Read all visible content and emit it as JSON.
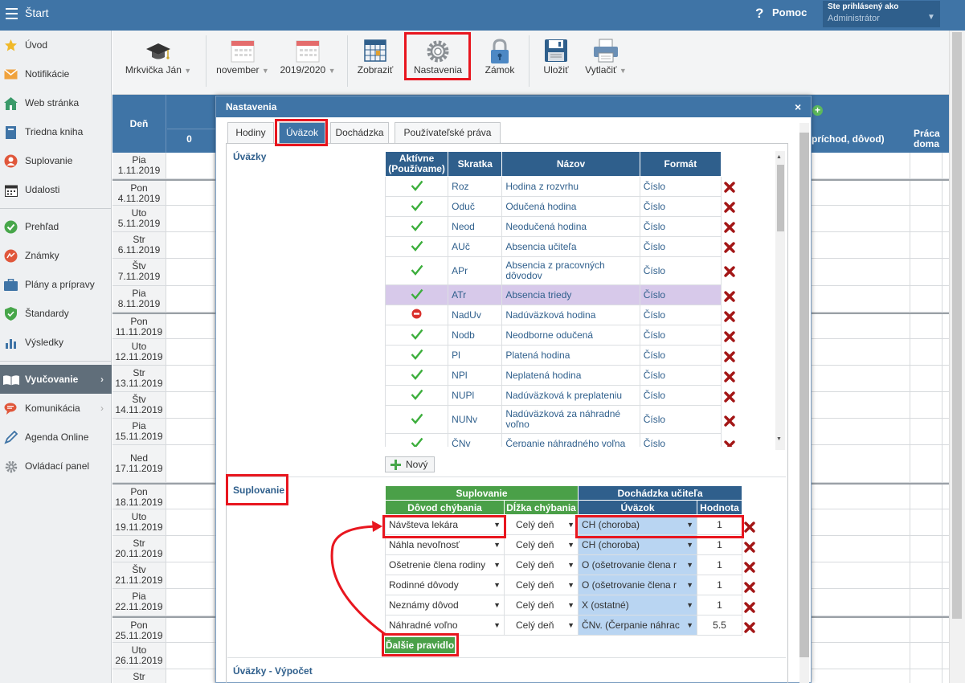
{
  "topbar": {
    "title": "Štart",
    "help_label": "Pomoc",
    "help_icon": "?",
    "user_line1": "Ste prihlásený ako",
    "user_line2": "Administrátor",
    "bg_color": "#3f74a6"
  },
  "sidebar": {
    "items": [
      {
        "label": "Úvod",
        "icon": "star-icon"
      },
      {
        "label": "Notifikácie",
        "icon": "envelope-icon"
      },
      {
        "label": "Web stránka",
        "icon": "home-icon"
      },
      {
        "label": "Triedna kniha",
        "icon": "book-icon"
      },
      {
        "label": "Suplovanie",
        "icon": "person-icon"
      },
      {
        "label": "Udalosti",
        "icon": "calendar-icon"
      },
      {
        "label": "Prehľad",
        "icon": "check-circle-icon"
      },
      {
        "label": "Známky",
        "icon": "grades-icon"
      },
      {
        "label": "Plány a prípravy",
        "icon": "briefcase-icon"
      },
      {
        "label": "Štandardy",
        "icon": "shield-icon"
      },
      {
        "label": "Výsledky",
        "icon": "bar-chart-icon"
      },
      {
        "label": "Vyučovanie",
        "icon": "open-book-icon"
      },
      {
        "label": "Komunikácia",
        "icon": "chat-icon"
      },
      {
        "label": "Agenda Online",
        "icon": "pen-icon"
      },
      {
        "label": "Ovládací panel",
        "icon": "gear-icon"
      }
    ]
  },
  "toolbar": {
    "teacher": "Mrkvička Ján",
    "month": "november",
    "year": "2019/2020",
    "show": "Zobraziť",
    "settings": "Nastavenia",
    "lock": "Zámok",
    "save": "Uložiť",
    "print": "Vytlačiť"
  },
  "calendar": {
    "header_day": "Deň",
    "header_zero": "0",
    "header_reason": "príchod, dôvod)",
    "header_home_1": "Práca",
    "header_home_2": "doma",
    "days": [
      {
        "d": "Pia",
        "date": "1.11.2019"
      },
      {
        "d": "Pon",
        "date": "4.11.2019"
      },
      {
        "d": "Uto",
        "date": "5.11.2019"
      },
      {
        "d": "Str",
        "date": "6.11.2019"
      },
      {
        "d": "Štv",
        "date": "7.11.2019"
      },
      {
        "d": "Pia",
        "date": "8.11.2019"
      },
      {
        "d": "Pon",
        "date": "11.11.2019"
      },
      {
        "d": "Uto",
        "date": "12.11.2019"
      },
      {
        "d": "Str",
        "date": "13.11.2019"
      },
      {
        "d": "Štv",
        "date": "14.11.2019"
      },
      {
        "d": "Pia",
        "date": "15.11.2019"
      },
      {
        "d": "Ned",
        "date": "17.11.2019"
      },
      {
        "d": "Pon",
        "date": "18.11.2019"
      },
      {
        "d": "Uto",
        "date": "19.11.2019"
      },
      {
        "d": "Str",
        "date": "20.11.2019"
      },
      {
        "d": "Štv",
        "date": "21.11.2019"
      },
      {
        "d": "Pia",
        "date": "22.11.2019"
      },
      {
        "d": "Pon",
        "date": "25.11.2019"
      },
      {
        "d": "Uto",
        "date": "26.11.2019"
      },
      {
        "d": "Str",
        "date": ""
      }
    ]
  },
  "modal": {
    "title": "Nastavenia",
    "close": "×",
    "tabs": [
      "Hodiny",
      "Úväzok",
      "Dochádzka",
      "Používateľské práva"
    ],
    "active_tab": "Úväzok",
    "uvazky": {
      "section_title": "Úväzky",
      "headers": [
        "Aktívne (Používame)",
        "Skratka",
        "Názov",
        "Formát"
      ],
      "rows": [
        {
          "active": "yes",
          "code": "Roz",
          "name": "Hodina z rozvrhu",
          "format": "Číslo"
        },
        {
          "active": "yes",
          "code": "Oduč",
          "name": "Odučená hodina",
          "format": "Číslo"
        },
        {
          "active": "yes",
          "code": "Neod",
          "name": "Neodučená hodina",
          "format": "Číslo"
        },
        {
          "active": "yes",
          "code": "AUč",
          "name": "Absencia učiteľa",
          "format": "Číslo"
        },
        {
          "active": "yes",
          "code": "APr",
          "name": "Absencia z pracovných dôvodov",
          "format": "Číslo"
        },
        {
          "active": "yes",
          "code": "ATr",
          "name": "Absencia triedy",
          "format": "Číslo"
        },
        {
          "active": "no",
          "code": "NadUv",
          "name": "Nadúväzková hodina",
          "format": "Číslo"
        },
        {
          "active": "yes",
          "code": "Nodb",
          "name": "Neodborne odučená",
          "format": "Číslo"
        },
        {
          "active": "yes",
          "code": "Pl",
          "name": "Platená hodina",
          "format": "Číslo"
        },
        {
          "active": "yes",
          "code": "NPl",
          "name": "Neplatená hodina",
          "format": "Číslo"
        },
        {
          "active": "yes",
          "code": "NUPl",
          "name": "Nadúväzková k preplateniu",
          "format": "Číslo"
        },
        {
          "active": "yes",
          "code": "NUNv",
          "name": "Nadúväzková za náhradné voľno",
          "format": "Číslo"
        },
        {
          "active": "yes",
          "code": "ČNv",
          "name": "Čerpanie náhradného voľna",
          "format": "Číslo"
        }
      ],
      "new_button": "Nový"
    },
    "suplovanie": {
      "section_title": "Suplovanie",
      "group_sup": "Suplovanie",
      "group_doch": "Dochádzka učiteľa",
      "headers": [
        "Dôvod chýbania",
        "Dĺžka chýbania",
        "Úväzok",
        "Hodnota"
      ],
      "rows": [
        {
          "reason": "Návšteva lekára",
          "length": "Celý deň",
          "uvazok": "CH (choroba)",
          "value": "1"
        },
        {
          "reason": "Náhla nevoľnosť",
          "length": "Celý deň",
          "uvazok": "CH (choroba)",
          "value": "1"
        },
        {
          "reason": "Ošetrenie člena rodiny",
          "length": "Celý deň",
          "uvazok": "O (ošetrovanie člena r",
          "value": "1"
        },
        {
          "reason": "Rodinné dôvody",
          "length": "Celý deň",
          "uvazok": "O (ošetrovanie člena r",
          "value": "1"
        },
        {
          "reason": "Neznámy dôvod",
          "length": "Celý deň",
          "uvazok": "X (ostatné)",
          "value": "1"
        },
        {
          "reason": "Náhradné voľno",
          "length": "Celý deň",
          "uvazok": "ČNv. (Čerpanie náhrac",
          "value": "5.5"
        }
      ],
      "add_button": "Ďalšie pravidlo"
    },
    "vypocet_title": "Úväzky - Výpočet"
  },
  "colors": {
    "accent_blue": "#3f74a6",
    "dark_blue": "#2f5f8c",
    "green": "#4aa048",
    "annotation_red": "#e8161f",
    "highlight_row": "#d7c9ea"
  }
}
